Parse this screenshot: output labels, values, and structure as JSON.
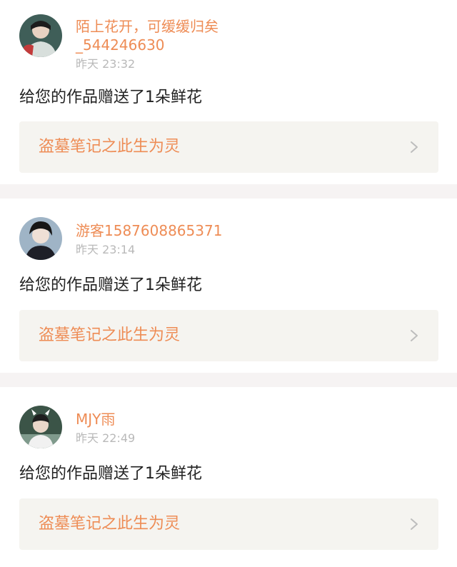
{
  "notifications": [
    {
      "username": "陌上花开，可缓缓归矣\n_544246630",
      "time": "昨天 23:32",
      "message": "给您的作品赠送了1朵鲜花",
      "work_title": "盗墓笔记之此生为灵",
      "avatar_icon": "user-avatar-icon"
    },
    {
      "username": "游客1587608865371",
      "time": "昨天 23:14",
      "message": "给您的作品赠送了1朵鲜花",
      "work_title": "盗墓笔记之此生为灵",
      "avatar_icon": "user-avatar-icon"
    },
    {
      "username": "MJY雨",
      "time": "昨天 22:49",
      "message": "给您的作品赠送了1朵鲜花",
      "work_title": "盗墓笔记之此生为灵",
      "avatar_icon": "user-avatar-icon"
    }
  ],
  "colors": {
    "accent": "#ee8c55",
    "timestamp": "#b9b9b9",
    "text": "#222222",
    "work_link_bg": "#f5f4f0",
    "divider": "#f6f3f3"
  }
}
